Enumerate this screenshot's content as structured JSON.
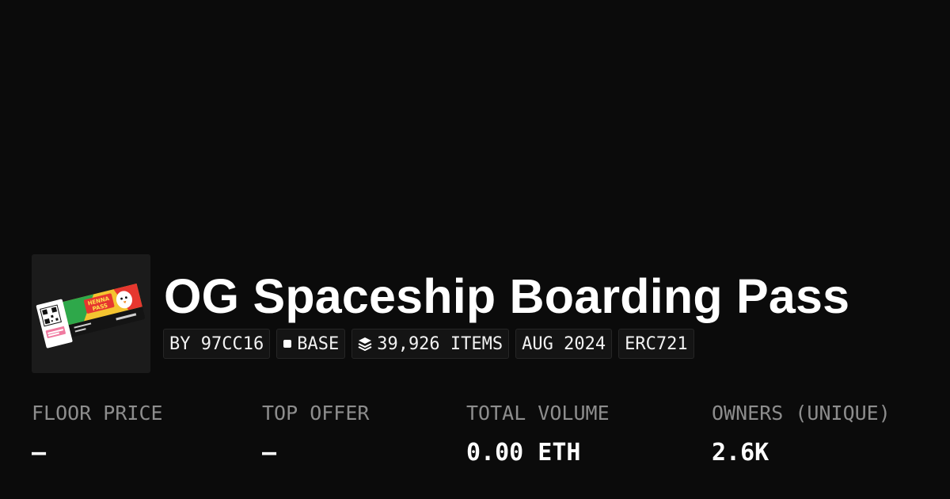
{
  "collection": {
    "name": "OG Spaceship Boarding Pass",
    "image": {
      "icon": "boarding-pass-ticket-illustration",
      "artwork_text": [
        "HENNA",
        "PASS"
      ]
    },
    "chips": {
      "creator": "BY 97CC16",
      "chain": "BASE",
      "chain_icon": "square-icon",
      "items": "39,926 ITEMS",
      "items_icon": "layers-icon",
      "date": "AUG 2024",
      "standard": "ERC721"
    }
  },
  "stats": [
    {
      "label": "FLOOR PRICE",
      "value": "–"
    },
    {
      "label": "TOP OFFER",
      "value": "–"
    },
    {
      "label": "TOTAL VOLUME",
      "value": "0.00 ETH"
    },
    {
      "label": "OWNERS (UNIQUE)",
      "value": "2.6K"
    }
  ],
  "colors": {
    "background": "#0b0b0b",
    "chip_background": "#141414",
    "label": "#8d8d8d",
    "text": "#ffffff"
  }
}
